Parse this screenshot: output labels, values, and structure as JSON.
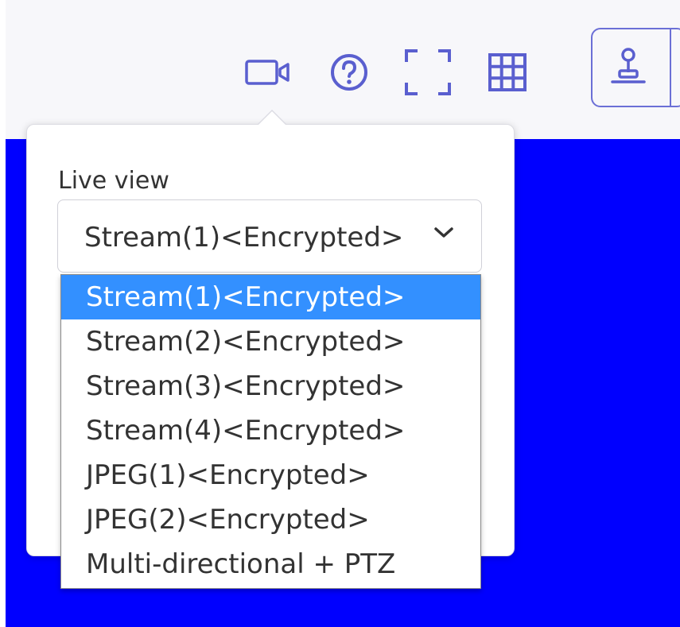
{
  "toolbar": {
    "icons": [
      "video-camera-icon",
      "help-icon",
      "fullscreen-icon",
      "grid-layout-icon"
    ],
    "ptz_icon": "joystick-icon",
    "accent_color": "#5a5fcf"
  },
  "live_area": {
    "background": "#0000ff"
  },
  "live_view": {
    "label": "Live view",
    "selected_value": "Stream(1)<Encrypted>",
    "options": [
      "Stream(1)<Encrypted>",
      "Stream(2)<Encrypted>",
      "Stream(3)<Encrypted>",
      "Stream(4)<Encrypted>",
      "JPEG(1)<Encrypted>",
      "JPEG(2)<Encrypted>",
      "Multi-directional + PTZ"
    ],
    "highlighted_index": 0,
    "highlight_color": "#3390ff"
  }
}
